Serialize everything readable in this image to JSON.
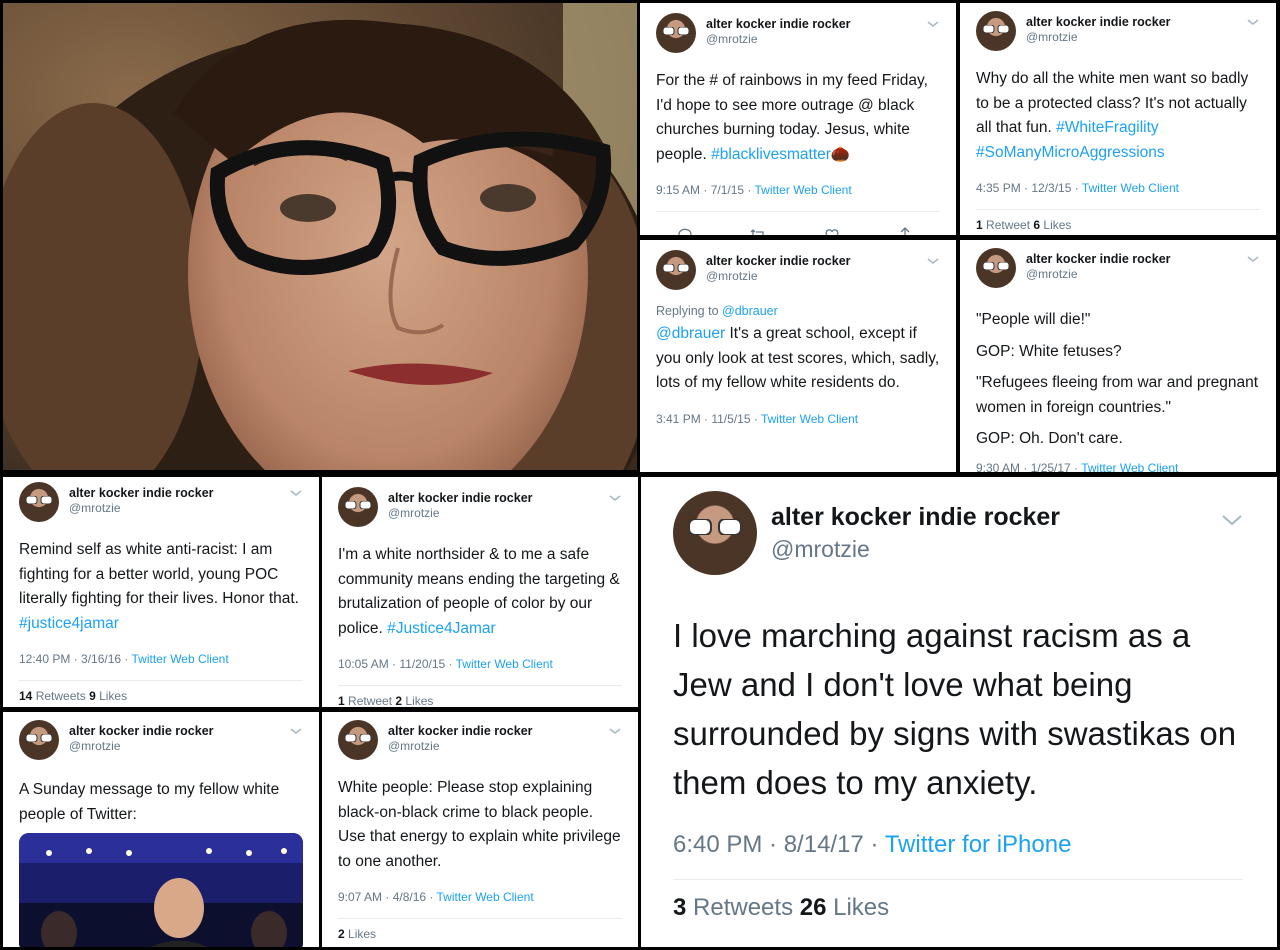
{
  "user": {
    "name": "alter kocker indie rocker",
    "handle": "@mrotzie"
  },
  "tweets": [
    {
      "text": "For the # of rainbows in my feed Friday, I'd hope to see more outrage @ black churches burning today. Jesus, white people. ",
      "hashtag": "#blacklivesmatter",
      "time": "9:15 AM · 7/1/15 · ",
      "client": "Twitter Web Client"
    },
    {
      "text": "Why do all the white men want so badly to be a protected class? It's not actually all that fun. ",
      "hashtag1": "#WhiteFragility",
      "hashtag2": "#SoManyMicroAggressions",
      "time": "4:35 PM · 12/3/15 · ",
      "client": "Twitter Web Client",
      "retweets": "1",
      "retweets_label": " Retweet ",
      "likes": "6",
      "likes_label": " Likes"
    },
    {
      "replying_label": "Replying to ",
      "replying_to": "@dbrauer",
      "mention": "@dbrauer",
      "text": " It's a great school, except if you only look at test scores, which, sadly, lots of my fellow white residents do.",
      "time": "3:41 PM · 11/5/15 · ",
      "client": "Twitter Web Client"
    },
    {
      "line1": "\"People will die!\"",
      "line2": "GOP: White fetuses?",
      "line3": "\"Refugees fleeing from war and pregnant women in foreign countries.\"",
      "line4": "GOP: Oh. Don't care.",
      "time": "9:30 AM · 1/25/17 · ",
      "client": "Twitter Web Client"
    },
    {
      "text": "Remind self as white anti-racist: I am fighting for a better world, young POC literally fighting for their lives. Honor that. ",
      "hashtag": "#justice4jamar",
      "time": "12:40 PM · 3/16/16 · ",
      "client": "Twitter Web Client",
      "retweets": "14",
      "retweets_label": " Retweets ",
      "likes": "9",
      "likes_label": " Likes"
    },
    {
      "text": "I'm a white northsider & to me a safe community means ending the targeting & brutalization of people of color by our police. ",
      "hashtag": "#Justice4Jamar",
      "time": "10:05 AM · 11/20/15 · ",
      "client": "Twitter Web Client",
      "retweets": "1",
      "retweets_label": " Retweet ",
      "likes": "2",
      "likes_label": " Likes"
    },
    {
      "text": "I love marching against racism as a Jew and I don't love what being surrounded by signs with swastikas on them does to my anxiety.",
      "time": "6:40 PM · 8/14/17 · ",
      "client": "Twitter for iPhone",
      "retweets": "3",
      "retweets_label": " Retweets ",
      "likes": "26",
      "likes_label": " Likes"
    },
    {
      "text": "A Sunday message to my fellow white people of Twitter:"
    },
    {
      "text": "White people: Please stop explaining black-on-black crime to black people. Use that energy to explain white privilege to one another.",
      "time": "9:07 AM · 4/8/16 · ",
      "client": "Twitter Web Client",
      "likes": "2",
      "likes_label": " Likes"
    }
  ],
  "colors": {
    "link": "#1da1f2",
    "muted": "#657786",
    "text": "#14171a",
    "background": "#000000"
  }
}
